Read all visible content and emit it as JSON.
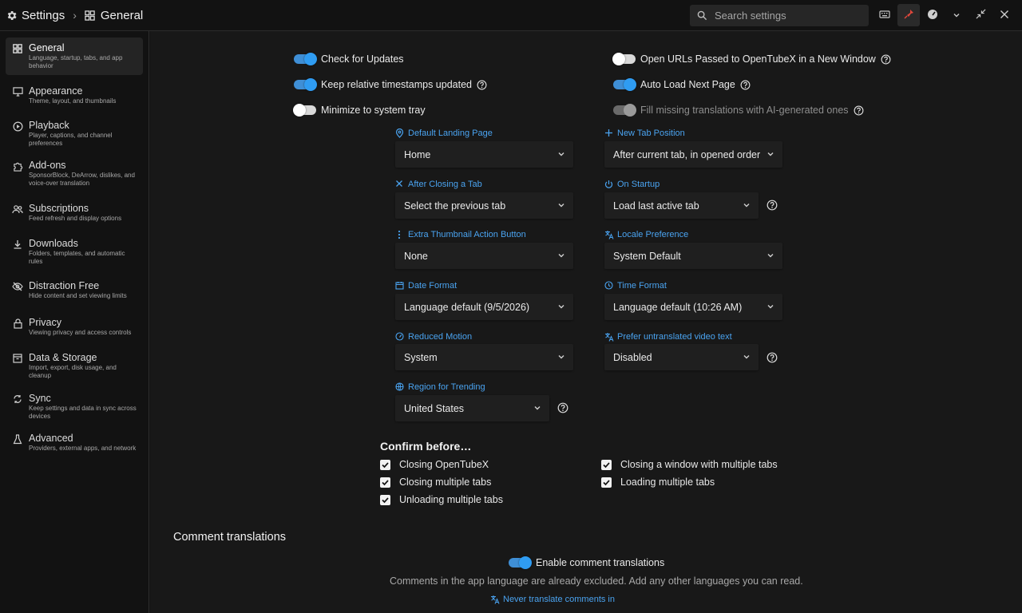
{
  "titlebar": {
    "app_title": "Settings",
    "page_title": "General",
    "search_placeholder": "Search settings",
    "buttons": [
      "keyboard-icon",
      "pin-icon",
      "speed-icon",
      "chevron-down-icon",
      "collapse-icon",
      "close-icon"
    ]
  },
  "sidebar": {
    "items": [
      {
        "title": "General",
        "desc": "Language, startup, tabs, and app behavior",
        "icon": "grid-icon"
      },
      {
        "title": "Appearance",
        "desc": "Theme, layout, and thumbnails",
        "icon": "monitor-icon"
      },
      {
        "title": "Playback",
        "desc": "Player, captions, and channel preferences",
        "icon": "play-circle-icon"
      },
      {
        "title": "Add-ons",
        "desc": "SponsorBlock, DeArrow, dislikes, and voice-over translation",
        "icon": "puzzle-icon"
      },
      {
        "title": "Subscriptions",
        "desc": "Feed refresh and display options",
        "icon": "people-icon"
      },
      {
        "title": "Downloads",
        "desc": "Folders, templates, and automatic rules",
        "icon": "download-icon"
      },
      {
        "title": "Distraction Free",
        "desc": "Hide content and set viewing limits",
        "icon": "eye-off-icon"
      },
      {
        "title": "Privacy",
        "desc": "Viewing privacy and access controls",
        "icon": "lock-icon"
      },
      {
        "title": "Data & Storage",
        "desc": "Import, export, disk usage, and cleanup",
        "icon": "archive-icon"
      },
      {
        "title": "Sync",
        "desc": "Keep settings and data in sync across devices",
        "icon": "sync-icon"
      },
      {
        "title": "Advanced",
        "desc": "Providers, external apps, and network",
        "icon": "flask-icon"
      }
    ]
  },
  "toggles": {
    "check_updates": "Check for Updates",
    "relative_timestamps": "Keep relative timestamps updated",
    "minimize_tray": "Minimize to system tray",
    "open_urls": "Open URLs Passed to OpenTubeX in a New Window",
    "auto_load": "Auto Load Next Page",
    "fill_translations": "Fill missing translations with AI-generated ones"
  },
  "fields": {
    "landing_label": "Default Landing Page",
    "landing_value": "Home",
    "newtab_label": "New Tab Position",
    "newtab_value": "After current tab, in opened order",
    "afterclose_label": "After Closing a Tab",
    "afterclose_value": "Select the previous tab",
    "startup_label": "On Startup",
    "startup_value": "Load last active tab",
    "thumb_label": "Extra Thumbnail Action Button",
    "thumb_value": "None",
    "locale_label": "Locale Preference",
    "locale_value": "System Default",
    "date_label": "Date Format",
    "date_value": "Language default (9/5/2026)",
    "time_label": "Time Format",
    "time_value": "Language default (10:26 AM)",
    "motion_label": "Reduced Motion",
    "motion_value": "System",
    "untranslated_label": "Prefer untranslated video text",
    "untranslated_value": "Disabled",
    "region_label": "Region for Trending",
    "region_value": "United States"
  },
  "confirm": {
    "title": "Confirm before…",
    "closing_app": "Closing OpenTubeX",
    "closing_window": "Closing a window with multiple tabs",
    "closing_tabs": "Closing multiple tabs",
    "loading_tabs": "Loading multiple tabs",
    "unloading_tabs": "Unloading multiple tabs"
  },
  "comments": {
    "title": "Comment translations",
    "enable": "Enable comment translations",
    "note": "Comments in the app language are already excluded. Add any other languages you can read.",
    "never_translate": "Never translate comments in"
  },
  "colors": {
    "accent": "#4aa3f0",
    "switch_on": "#2f9cf2",
    "background": "#181818",
    "sidebar": "#121212"
  }
}
